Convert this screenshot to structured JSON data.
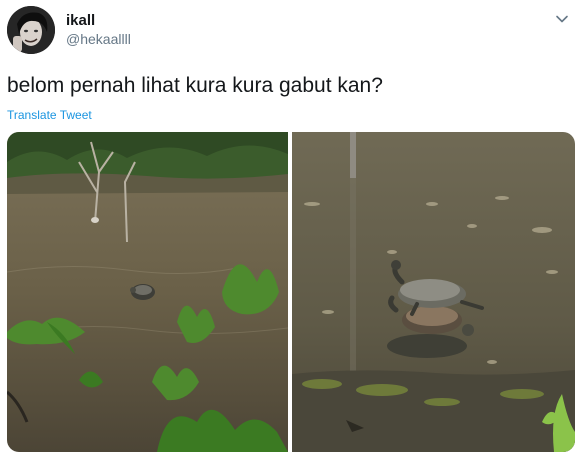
{
  "tweet": {
    "author_name": "ikall",
    "author_handle": "@hekaallll",
    "text": "belom pernah lihat kura kura gabut kan?",
    "translate_label": "Translate Tweet"
  },
  "icons": {
    "menu": "chevron-down-icon"
  },
  "colors": {
    "link": "#1b95e0",
    "secondary_text": "#657786"
  },
  "media": {
    "photo_count": 2
  }
}
